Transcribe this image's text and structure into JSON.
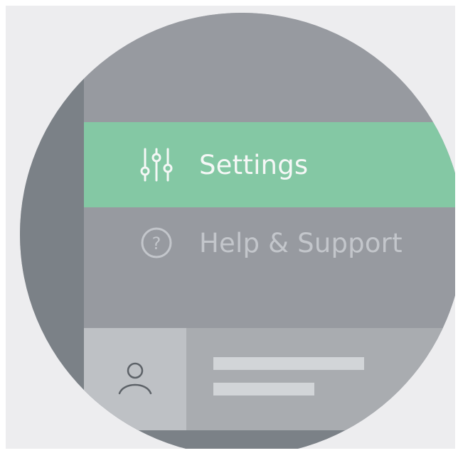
{
  "colors": {
    "background": "#ededef",
    "rail": "#7b8187",
    "panel": "#979aa0",
    "active_item": "#84c8a4",
    "account_strip": "#a9acb0",
    "avatar_box": "#bec1c5",
    "placeholder": "#d2d5d8"
  },
  "menu": {
    "items": [
      {
        "label": "Settings",
        "icon": "sliders-icon",
        "active": true
      },
      {
        "label": "Help & Support",
        "icon": "help-circle-icon",
        "active": false
      }
    ]
  },
  "account": {
    "avatar_icon": "user-icon"
  }
}
